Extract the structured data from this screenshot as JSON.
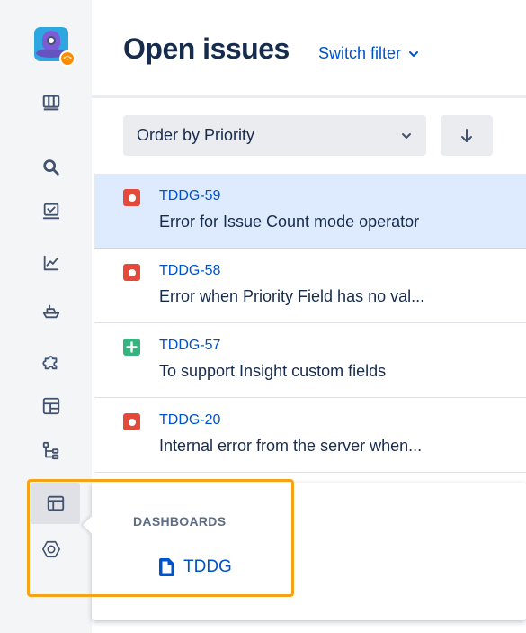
{
  "header": {
    "title": "Open issues",
    "switch_filter_label": "Switch filter"
  },
  "controls": {
    "order_label": "Order by Priority",
    "sort_direction_icon": "arrow-down-icon"
  },
  "issues": [
    {
      "key": "TDDG-59",
      "summary": "Error for Issue Count mode operator",
      "type": "bug",
      "selected": true
    },
    {
      "key": "TDDG-58",
      "summary": "Error when Priority Field has no val...",
      "type": "bug",
      "selected": false
    },
    {
      "key": "TDDG-57",
      "summary": "To support Insight custom fields",
      "type": "story",
      "selected": false
    },
    {
      "key": "TDDG-20",
      "summary": "Internal error from the server when...",
      "type": "bug",
      "selected": false
    }
  ],
  "sidebar": {
    "icons": [
      "board-icon",
      "search-icon",
      "monitor-icon",
      "chart-icon",
      "ship-icon",
      "puzzle-icon",
      "table-icon",
      "hierarchy-icon",
      "dashboard-icon",
      "hexagon-icon"
    ]
  },
  "flyout": {
    "heading": "DASHBOARDS",
    "items": [
      {
        "label": "TDDG"
      }
    ]
  },
  "colors": {
    "link": "#0052cc",
    "bug": "#e5493a",
    "story": "#36b37e",
    "selected_row": "#deebff",
    "highlight": "#f6a318"
  }
}
